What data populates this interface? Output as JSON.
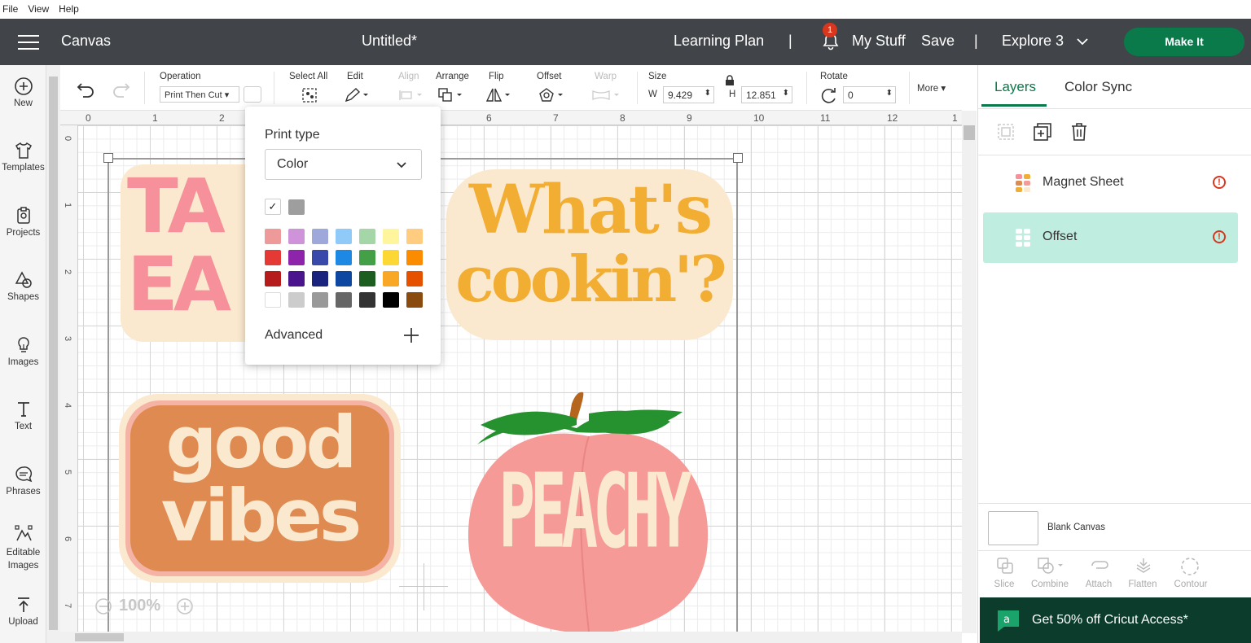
{
  "menu": [
    "File",
    "View",
    "Help"
  ],
  "header": {
    "title": "Canvas",
    "doc_name": "Untitled*",
    "learning_plan": "Learning Plan",
    "separator": "|",
    "notification_count": "1",
    "my_stuff": "My Stuff",
    "save": "Save",
    "machine": "Explore 3",
    "make_it": "Make It"
  },
  "sidebar": [
    {
      "label": "New",
      "icon": "plus-circle-icon"
    },
    {
      "label": "Templates",
      "icon": "shirt-icon"
    },
    {
      "label": "Projects",
      "icon": "clipboard-icon"
    },
    {
      "label": "Shapes",
      "icon": "shapes-icon"
    },
    {
      "label": "Images",
      "icon": "lightbulb-icon"
    },
    {
      "label": "Text",
      "icon": "text-icon"
    },
    {
      "label": "Phrases",
      "icon": "speech-bubble-icon"
    },
    {
      "label": "Editable Images",
      "icon": "editable-image-icon"
    },
    {
      "label": "Upload",
      "icon": "upload-icon"
    }
  ],
  "toolbar": {
    "operation_label": "Operation",
    "operation_value": "Print Then Cut",
    "select_all": "Select All",
    "edit": "Edit",
    "align": "Align",
    "arrange": "Arrange",
    "flip": "Flip",
    "offset": "Offset",
    "warp": "Warp",
    "size": "Size",
    "w_label": "W",
    "w_value": "9.429",
    "h_label": "H",
    "h_value": "12.851",
    "rotate": "Rotate",
    "rotate_value": "0",
    "more": "More"
  },
  "ruler": {
    "top": [
      "0",
      "1",
      "2",
      "3",
      "4",
      "5",
      "6",
      "7",
      "8",
      "9",
      "10",
      "11",
      "12",
      "1"
    ],
    "left": [
      "0",
      "1",
      "2",
      "3",
      "4",
      "5",
      "6",
      "7"
    ]
  },
  "zoom": "100%",
  "print_type_popup": {
    "title": "Print type",
    "selected": "Color",
    "selected_swatch": "#9e9e9e",
    "palette": [
      [
        "#ef9a9a",
        "#ce93d8",
        "#9fa8da",
        "#90caf9",
        "#a5d6a7",
        "#fff59d",
        "#ffcc80"
      ],
      [
        "#e53935",
        "#8e24aa",
        "#3949ab",
        "#1e88e5",
        "#43a047",
        "#fdd835",
        "#fb8c00"
      ],
      [
        "#b71c1c",
        "#4a148c",
        "#1a237e",
        "#0d47a1",
        "#1b5e20",
        "#f9a825",
        "#e65100"
      ],
      [
        "#ffffff",
        "#cccccc",
        "#999999",
        "#666666",
        "#333333",
        "#000000",
        "#8a4b0f"
      ]
    ],
    "advanced": "Advanced"
  },
  "stickers": {
    "whats": "What's",
    "cookin": "cookin'?",
    "good": "good",
    "vibes": "vibes",
    "peachy": "PEACHY",
    "partial_1": "TA",
    "partial_2": "EA"
  },
  "right_panel": {
    "tabs": [
      "Layers",
      "Color Sync"
    ],
    "layers": [
      {
        "name": "Magnet Sheet"
      },
      {
        "name": "Offset",
        "selected": true
      }
    ],
    "blank_canvas": "Blank Canvas",
    "actions": [
      "Slice",
      "Combine",
      "Attach",
      "Flatten",
      "Contour"
    ],
    "promo": "Get 50% off Cricut Access*"
  }
}
